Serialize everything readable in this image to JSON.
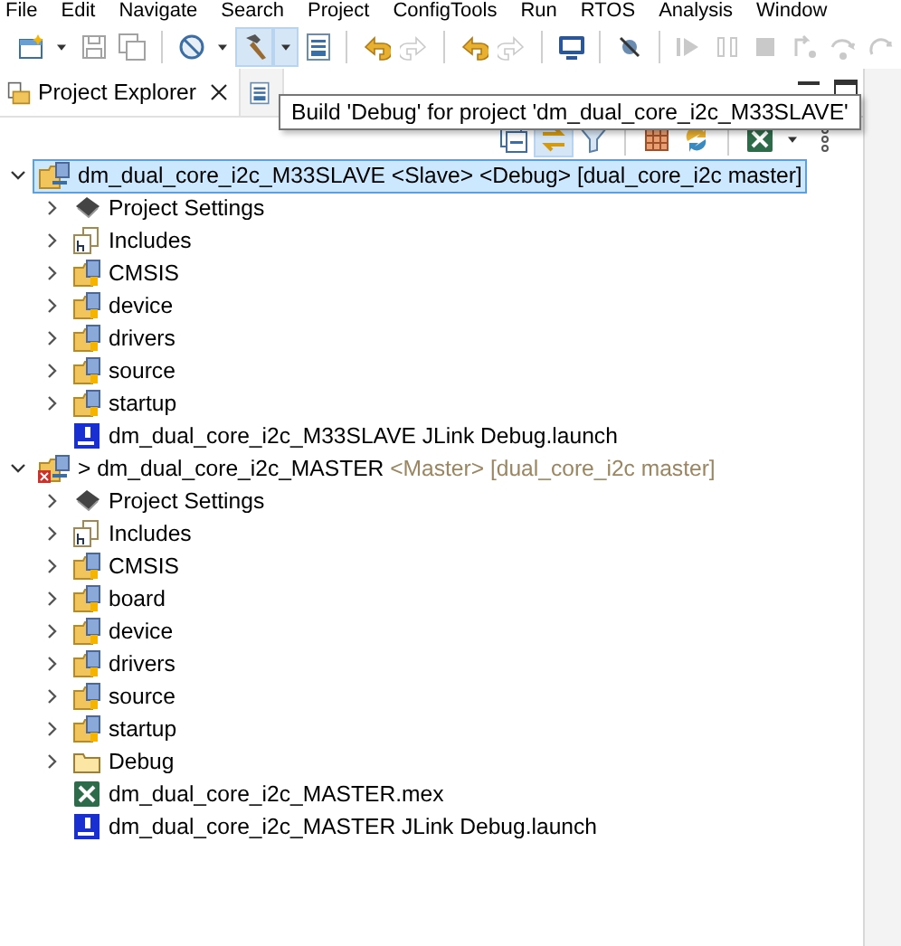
{
  "menu": [
    "File",
    "Edit",
    "Navigate",
    "Search",
    "Project",
    "ConfigTools",
    "Run",
    "RTOS",
    "Analysis",
    "Window"
  ],
  "toolbar": [
    {
      "kind": "new",
      "disabled": false,
      "pressed": false,
      "dropdown": true
    },
    {
      "kind": "save",
      "disabled": true,
      "pressed": false,
      "dropdown": false
    },
    {
      "kind": "save-all",
      "disabled": true,
      "pressed": false,
      "dropdown": false
    },
    {
      "kind": "separator"
    },
    {
      "kind": "debug-config",
      "disabled": false,
      "pressed": false,
      "dropdown": true
    },
    {
      "kind": "hammer",
      "disabled": false,
      "pressed": true,
      "dropdown": true
    },
    {
      "kind": "binary",
      "disabled": false,
      "pressed": false,
      "dropdown": false
    },
    {
      "kind": "separator"
    },
    {
      "kind": "back",
      "disabled": false,
      "pressed": false,
      "dropdown": false
    },
    {
      "kind": "forward",
      "disabled": true,
      "pressed": false,
      "dropdown": false
    },
    {
      "kind": "separator"
    },
    {
      "kind": "back",
      "disabled": false,
      "pressed": false,
      "dropdown": false
    },
    {
      "kind": "forward",
      "disabled": true,
      "pressed": false,
      "dropdown": false
    },
    {
      "kind": "separator"
    },
    {
      "kind": "monitor",
      "disabled": false,
      "pressed": false,
      "dropdown": false
    },
    {
      "kind": "separator"
    },
    {
      "kind": "disconnect",
      "disabled": false,
      "pressed": false,
      "dropdown": false
    },
    {
      "kind": "separator"
    },
    {
      "kind": "resume",
      "disabled": true,
      "pressed": false,
      "dropdown": false
    },
    {
      "kind": "suspend",
      "disabled": true,
      "pressed": false,
      "dropdown": false
    },
    {
      "kind": "stop",
      "disabled": true,
      "pressed": false,
      "dropdown": false
    },
    {
      "kind": "step-into",
      "disabled": true,
      "pressed": false,
      "dropdown": false
    },
    {
      "kind": "step-over",
      "disabled": true,
      "pressed": false,
      "dropdown": false
    },
    {
      "kind": "step-return",
      "disabled": true,
      "pressed": false,
      "dropdown": false
    }
  ],
  "tabs": [
    {
      "label": "Project Explorer",
      "kind": "explorer",
      "selected": true,
      "closable": true
    },
    {
      "kind": "binary",
      "selected": false,
      "closable": false
    }
  ],
  "tooltip": "Build 'Debug' for project 'dm_dual_core_i2c_M33SLAVE'",
  "view_toolbar": [
    {
      "kind": "collapse",
      "pressed": false
    },
    {
      "kind": "link",
      "pressed": true
    },
    {
      "kind": "filter",
      "pressed": false
    },
    {
      "kind": "separator"
    },
    {
      "kind": "grid",
      "pressed": false
    },
    {
      "kind": "sync",
      "pressed": false
    },
    {
      "kind": "separator"
    },
    {
      "kind": "mex",
      "pressed": false
    },
    {
      "kind": "caret",
      "pressed": false
    },
    {
      "kind": "dots",
      "pressed": false
    }
  ],
  "tree": [
    {
      "kind": "project",
      "label": "dm_dual_core_i2c_M33SLAVE <Slave> <Debug> [dual_core_i2c master]",
      "error": false,
      "selected": true,
      "expanded": true,
      "children": [
        {
          "kind": "settings",
          "label": "Project Settings",
          "expanded": false,
          "selected": false
        },
        {
          "kind": "includes",
          "label": "Includes",
          "expanded": false,
          "selected": false
        },
        {
          "kind": "source-folder",
          "label": "CMSIS",
          "expanded": false,
          "selected": false
        },
        {
          "kind": "source-folder",
          "label": "device",
          "expanded": false,
          "selected": false
        },
        {
          "kind": "source-folder",
          "label": "drivers",
          "expanded": false,
          "selected": false
        },
        {
          "kind": "source-folder",
          "label": "source",
          "expanded": false,
          "selected": false
        },
        {
          "kind": "source-folder",
          "label": "startup",
          "expanded": false,
          "selected": false
        },
        {
          "kind": "launch",
          "label": "dm_dual_core_i2c_M33SLAVE JLink Debug.launch",
          "selected": false
        }
      ]
    },
    {
      "kind": "project",
      "label": "> dm_dual_core_i2c_MASTER",
      "decoration": " <Master> [dual_core_i2c master]",
      "error": true,
      "selected": false,
      "expanded": true,
      "children": [
        {
          "kind": "settings",
          "label": "Project Settings",
          "expanded": false,
          "selected": false
        },
        {
          "kind": "includes",
          "label": "Includes",
          "expanded": false,
          "selected": false
        },
        {
          "kind": "source-folder",
          "label": "CMSIS",
          "expanded": false,
          "selected": false
        },
        {
          "kind": "source-folder",
          "label": "board",
          "expanded": false,
          "selected": false
        },
        {
          "kind": "source-folder",
          "label": "device",
          "expanded": false,
          "selected": false
        },
        {
          "kind": "source-folder",
          "label": "drivers",
          "expanded": false,
          "selected": false
        },
        {
          "kind": "source-folder",
          "label": "source",
          "expanded": false,
          "selected": false
        },
        {
          "kind": "source-folder",
          "label": "startup",
          "expanded": false,
          "selected": false
        },
        {
          "kind": "folder",
          "label": "Debug",
          "expanded": false,
          "selected": false
        },
        {
          "kind": "mex",
          "label": "dm_dual_core_i2c_MASTER.mex",
          "selected": false
        },
        {
          "kind": "launch",
          "label": "dm_dual_core_i2c_MASTER JLink Debug.launch",
          "selected": false
        }
      ]
    }
  ]
}
